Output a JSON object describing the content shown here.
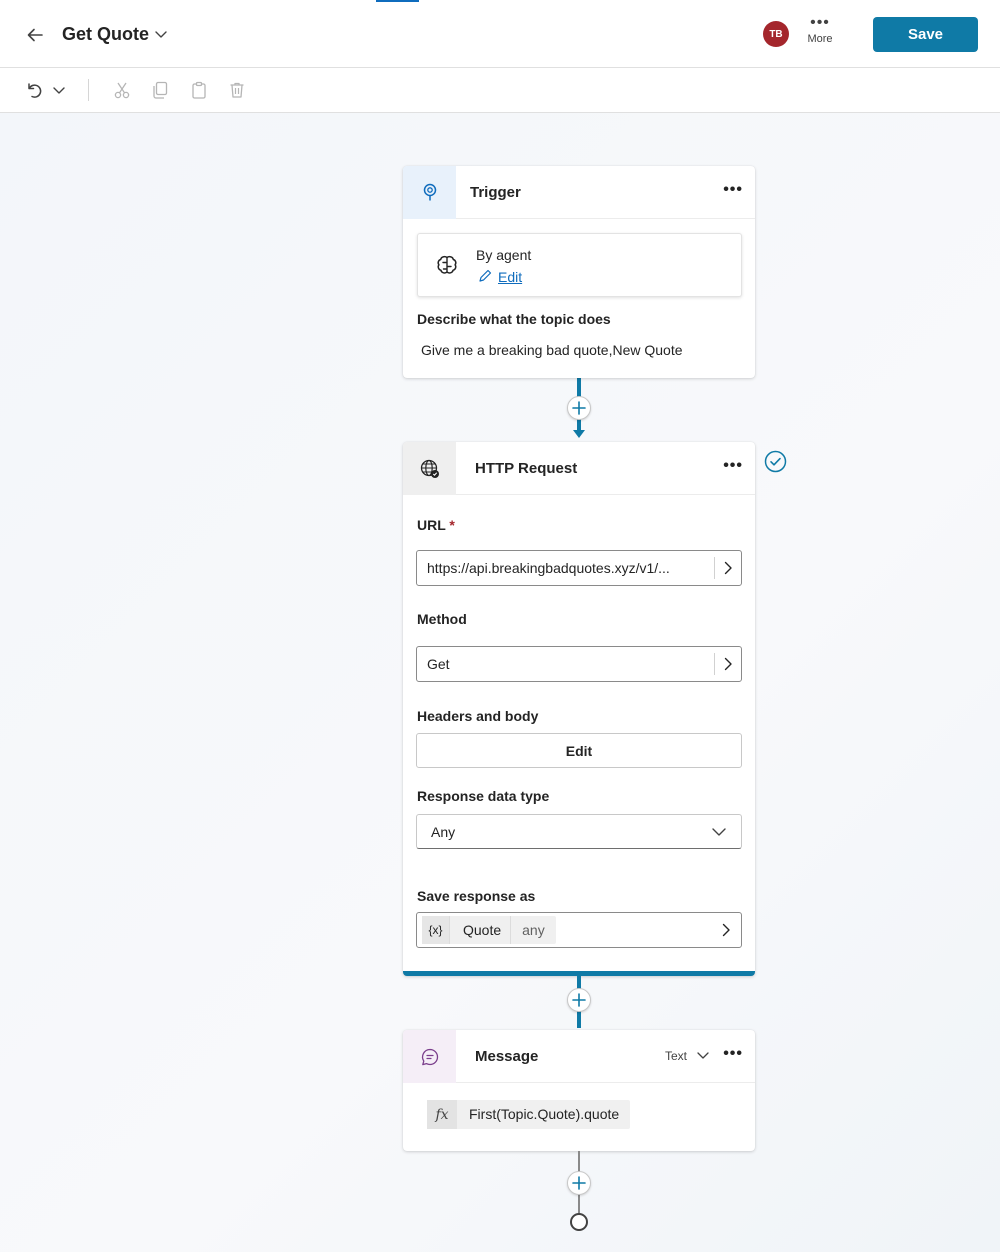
{
  "header": {
    "title": "Get Quote",
    "avatar_initials": "TB",
    "more_label": "More",
    "save_label": "Save"
  },
  "colors": {
    "accent": "#0f7aa6",
    "avatar_bg": "#a4262c",
    "required": "#a4262c"
  },
  "toolbar": {
    "icons": [
      "undo-icon",
      "chevron-down-icon",
      "cut-icon",
      "copy-icon",
      "paste-icon",
      "delete-icon"
    ]
  },
  "trigger": {
    "title": "Trigger",
    "by_label": "By agent",
    "edit_label": "Edit",
    "describe_label": "Describe what the topic does",
    "describe_value": "Give me a breaking bad quote,New Quote"
  },
  "http": {
    "title": "HTTP Request",
    "url_label": "URL",
    "url_required": "*",
    "url_value": "https://api.breakingbadquotes.xyz/v1/...",
    "method_label": "Method",
    "method_value": "Get",
    "headers_label": "Headers and body",
    "headers_button": "Edit",
    "response_type_label": "Response data type",
    "response_type_value": "Any",
    "save_as_label": "Save response as",
    "var_token": "{x}",
    "var_name": "Quote",
    "var_type": "any"
  },
  "message": {
    "title": "Message",
    "type_label": "Text",
    "fx_token": "fx",
    "formula": "First(Topic.Quote).quote"
  }
}
